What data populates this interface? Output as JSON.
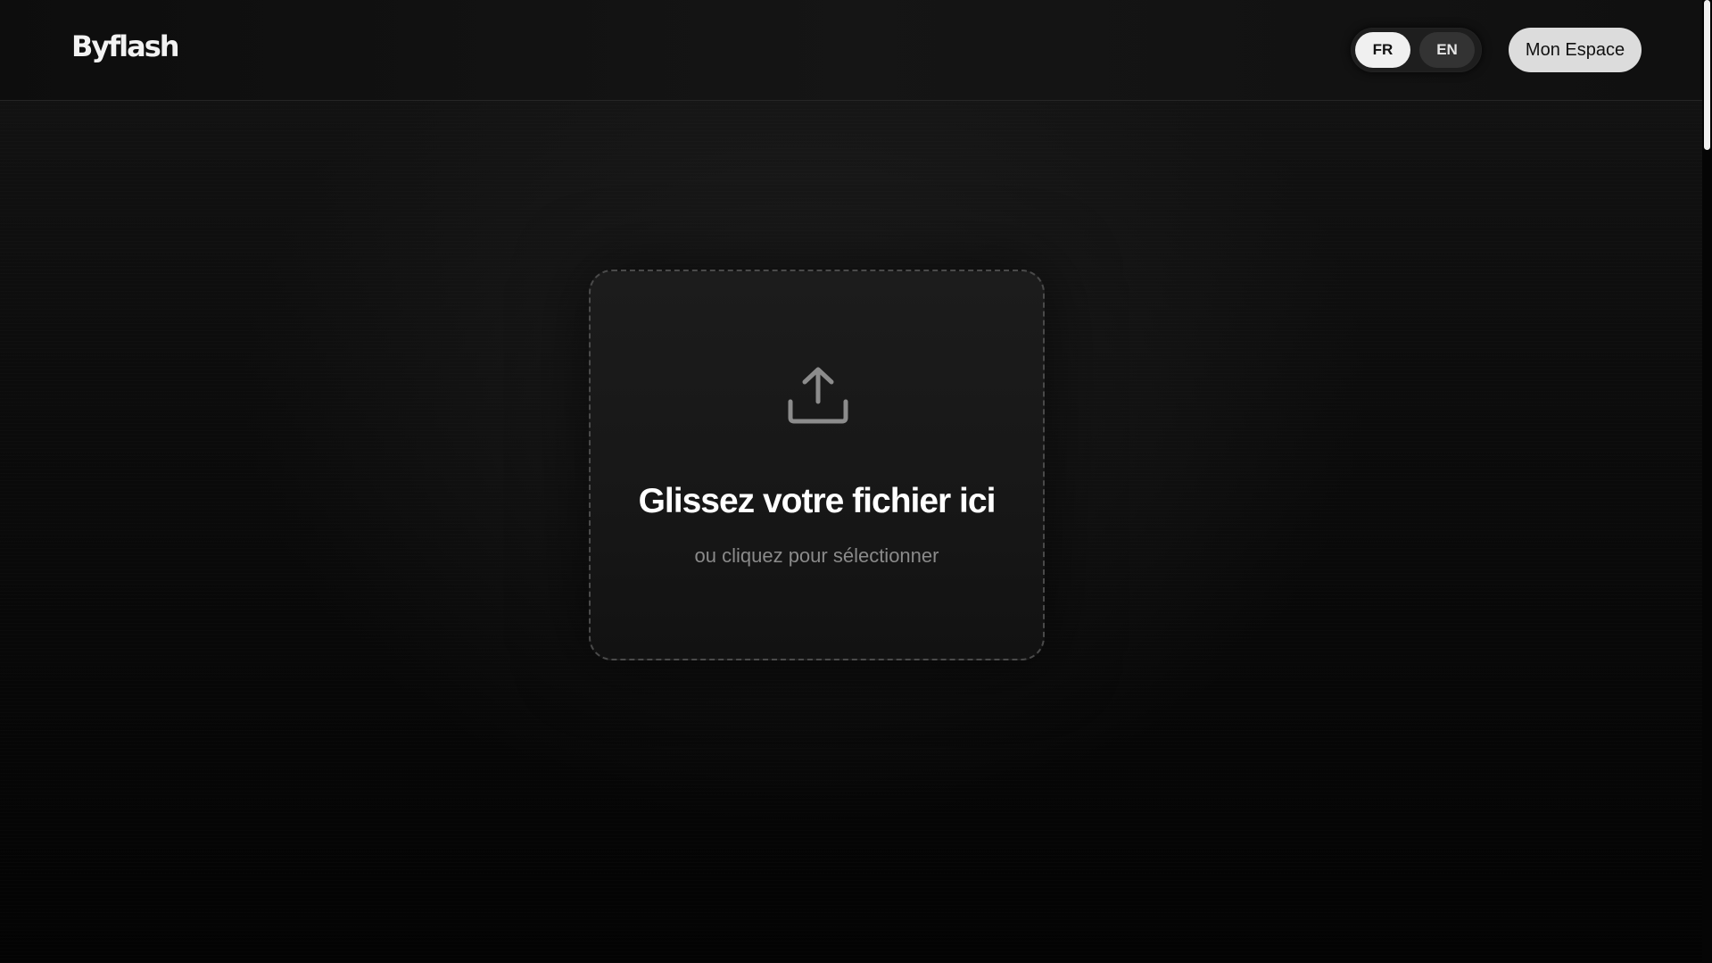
{
  "header": {
    "logo_text": "Byflash",
    "languages": [
      {
        "label": "FR",
        "active": true
      },
      {
        "label": "EN",
        "active": false
      }
    ],
    "account_label": "Mon Espace"
  },
  "dropzone": {
    "icon": "upload-icon",
    "title": "Glissez votre fichier ici",
    "subtitle": "ou cliquez pour sélectionner"
  },
  "colors": {
    "background": "#000000",
    "dropzone_border": "#4a4a4a",
    "active_lang_bg": "#f0f0f0",
    "account_button_bg": "#dcdcdc",
    "icon_color": "#8c8c8c"
  }
}
